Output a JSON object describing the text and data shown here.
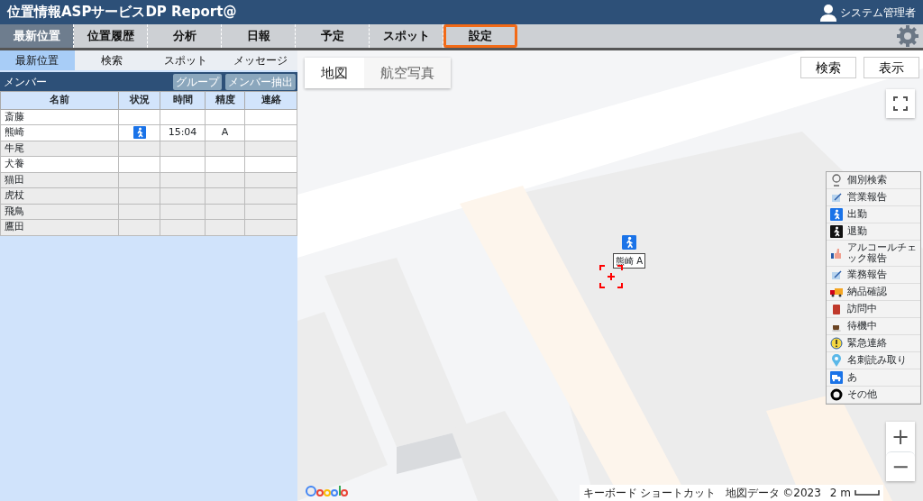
{
  "header": {
    "title": "位置情報ASPサービスDP Report@",
    "user": "システム管理者"
  },
  "main_tabs": [
    {
      "label": "最新位置",
      "selected": true,
      "highlighted": false
    },
    {
      "label": "位置履歴",
      "selected": false,
      "highlighted": false
    },
    {
      "label": "分析",
      "selected": false,
      "highlighted": false
    },
    {
      "label": "日報",
      "selected": false,
      "highlighted": false
    },
    {
      "label": "予定",
      "selected": false,
      "highlighted": false
    },
    {
      "label": "スポット",
      "selected": false,
      "highlighted": false
    },
    {
      "label": "設定",
      "selected": false,
      "highlighted": true
    }
  ],
  "sub_tabs": [
    {
      "label": "最新位置",
      "selected": true
    },
    {
      "label": "検索",
      "selected": false
    },
    {
      "label": "スポット",
      "selected": false
    },
    {
      "label": "メッセージ",
      "selected": false
    }
  ],
  "members": {
    "title": "メンバー",
    "buttons": [
      "グループ",
      "メンバー抽出"
    ],
    "columns": [
      "名前",
      "状況",
      "時間",
      "精度",
      "連絡"
    ],
    "rows": [
      {
        "name": "斎藤",
        "kind": "idle",
        "time": "",
        "accuracy": "",
        "active": true
      },
      {
        "name": "熊崎",
        "kind": "walking",
        "time": "15:04",
        "accuracy": "A",
        "active": true
      },
      {
        "name": "牛尾",
        "kind": "idle",
        "time": "",
        "accuracy": "",
        "active": false
      },
      {
        "name": "犬養",
        "kind": "idle",
        "time": "",
        "accuracy": "",
        "active": true
      },
      {
        "name": "猫田",
        "kind": "idle",
        "time": "",
        "accuracy": "",
        "active": false
      },
      {
        "name": "虎杖",
        "kind": "idle",
        "time": "",
        "accuracy": "",
        "active": false
      },
      {
        "name": "飛鳥",
        "kind": "idle",
        "time": "",
        "accuracy": "",
        "active": false
      },
      {
        "name": "鷹田",
        "kind": "idle",
        "time": "",
        "accuracy": "",
        "active": false
      }
    ]
  },
  "map": {
    "type_buttons": [
      {
        "label": "地図",
        "selected": true
      },
      {
        "label": "航空写真",
        "selected": false
      }
    ],
    "action_buttons": [
      "検索",
      "表示"
    ],
    "marker": {
      "label": "熊崎 A",
      "kind": "walking"
    },
    "zoom_buttons": [
      "+",
      "−"
    ],
    "legend": [
      {
        "label": "個別検索",
        "kind": "person"
      },
      {
        "label": "営業報告",
        "kind": "memo"
      },
      {
        "label": "出勤",
        "kind": "walkin"
      },
      {
        "label": "退勤",
        "kind": "walkout"
      },
      {
        "label": "アルコールチェック報告",
        "kind": "thumb"
      },
      {
        "label": "業務報告",
        "kind": "memo"
      },
      {
        "label": "納品確認",
        "kind": "truck"
      },
      {
        "label": "訪問中",
        "kind": "bag"
      },
      {
        "label": "待機中",
        "kind": "cup"
      },
      {
        "label": "緊急連絡",
        "kind": "alert"
      },
      {
        "label": "名刺読み取り",
        "kind": "pin"
      },
      {
        "label": "あ",
        "kind": "van"
      },
      {
        "label": "その他",
        "kind": "ring"
      }
    ],
    "footer": {
      "shortcuts": "キーボード ショートカット",
      "copyright": "地図データ ©2023",
      "scale": "2 m"
    }
  }
}
